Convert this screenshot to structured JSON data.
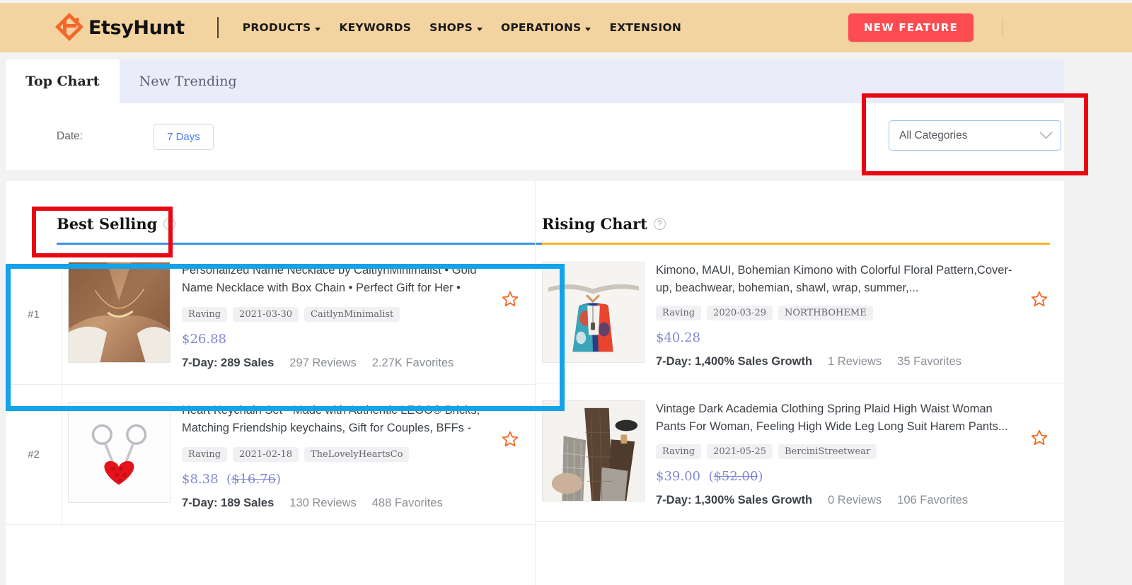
{
  "nav": {
    "brand": "EtsyHunt",
    "items": [
      {
        "label": "PRODUCTS",
        "has_caret": true
      },
      {
        "label": "KEYWORDS",
        "has_caret": false
      },
      {
        "label": "SHOPS",
        "has_caret": true
      },
      {
        "label": "OPERATIONS",
        "has_caret": true
      },
      {
        "label": "EXTENSION",
        "has_caret": false
      }
    ],
    "new_feature_label": "NEW FEATURE",
    "accent_color": "#fd4b52",
    "bar_color": "#f3d4a0"
  },
  "tabs": {
    "items": [
      {
        "label": "Top Chart",
        "active": true
      },
      {
        "label": "New Trending",
        "active": false
      }
    ]
  },
  "filters": {
    "date_label": "Date:",
    "date_value": "7 Days",
    "category_value": "All Categories",
    "category_icon": "chevron-down-icon"
  },
  "highlights": {
    "category_box_color": "#ea0712",
    "best_selling_box_color": "#ea0712",
    "row_box_color": "#12a3e8"
  },
  "best_selling": {
    "title": "Best Selling",
    "help_icon": "question-mark-icon",
    "underline_color": "#3b93e8",
    "items": [
      {
        "rank": "#1",
        "title": "Personalized Name Necklace by CaitlynMinimalist • Gold Name Necklace with Box Chain • Perfect Gift for Her • Personalized Gift...",
        "tags": [
          "Raving",
          "2021-03-30",
          "CaitlynMinimalist"
        ],
        "price": "$26.88",
        "old_price": "",
        "stat_lead_label": "7-Day:",
        "stat_lead_value": "289 Sales",
        "reviews": "297 Reviews",
        "favorites": "2.27K Favorites",
        "favorite_icon": "star-outline-icon",
        "thumb": "necklace-photo"
      },
      {
        "rank": "#2",
        "title": "Heart Keychain Set - Made with Authentic LEGO® Bricks, Matching Friendship keychains, Gift for Couples, BFFs - Very High Quality ...",
        "tags": [
          "Raving",
          "2021-02-18",
          "TheLovelyHeartsCo"
        ],
        "price": "$8.38",
        "old_price": "$16.76",
        "stat_lead_label": "7-Day:",
        "stat_lead_value": "189 Sales",
        "reviews": "130 Reviews",
        "favorites": "488 Favorites",
        "favorite_icon": "star-outline-icon",
        "thumb": "heart-keychain-photo"
      }
    ]
  },
  "rising_chart": {
    "title": "Rising Chart",
    "help_icon": "question-mark-icon",
    "underline_color": "#f5b324",
    "items": [
      {
        "rank": "",
        "title": "Kimono, MAUI, Bohemian Kimono with Colorful Floral Pattern,Cover-up, beachwear, bohemian, shawl, wrap, summer,...",
        "tags": [
          "Raving",
          "2020-03-29",
          "NORTHBOHEME"
        ],
        "price": "$40.28",
        "old_price": "",
        "stat_lead_label": "7-Day:",
        "stat_lead_value": "1,400% Sales Growth",
        "reviews": "1 Reviews",
        "favorites": "35 Favorites",
        "favorite_icon": "star-outline-icon",
        "thumb": "kimono-photo"
      },
      {
        "rank": "",
        "title": "Vintage Dark Academia Clothing Spring Plaid High Waist Woman Pants For Woman, Feeling High Wide Leg Long Suit Harem Pants...",
        "tags": [
          "Raving",
          "2021-05-25",
          "BerciniStreetwear"
        ],
        "price": "$39.00",
        "old_price": "$52.00",
        "stat_lead_label": "7-Day:",
        "stat_lead_value": "1,300% Sales Growth",
        "reviews": "0 Reviews",
        "favorites": "106 Favorites",
        "favorite_icon": "star-outline-icon",
        "thumb": "plaid-pants-photo"
      }
    ]
  }
}
